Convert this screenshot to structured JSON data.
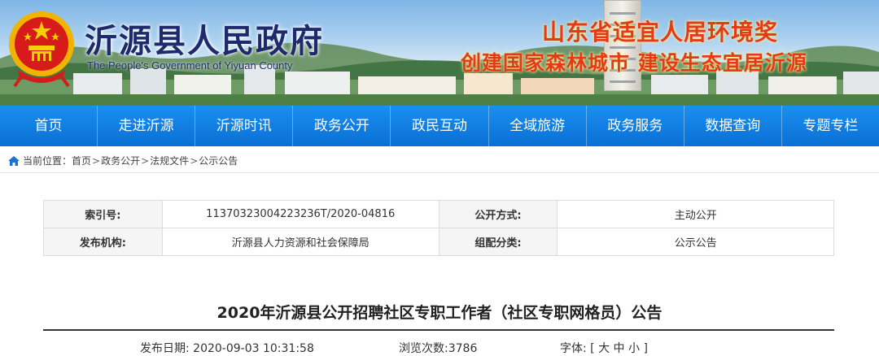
{
  "banner": {
    "title": "沂源县人民政府",
    "subtitle": "The People's Government of Yiyuan County",
    "slogan_line1": "山东省适宜人居环境奖",
    "slogan_line2": "创建国家森林城市 建设生态宜居沂源"
  },
  "nav": {
    "items": [
      "首页",
      "走进沂源",
      "沂源时讯",
      "政务公开",
      "政民互动",
      "全域旅游",
      "政务服务",
      "数据查询",
      "专题专栏"
    ]
  },
  "breadcrumb": {
    "prefix": "当前位置：",
    "items": [
      "首页",
      "政务公开",
      "法规文件",
      "公示公告"
    ],
    "separator": ">"
  },
  "info": {
    "index_label": "索引号:",
    "index_value": "11370323004223236T/2020-04816",
    "method_label": "公开方式:",
    "method_value": "主动公开",
    "publisher_label": "发布机构:",
    "publisher_value": "沂源县人力资源和社会保障局",
    "category_label": "组配分类:",
    "category_value": "公示公告"
  },
  "article": {
    "title": "2020年沂源县公开招聘社区专职工作者（社区专职网格员）公告",
    "date_label": "发布日期:",
    "date_value": "2020-09-03 10:31:58",
    "views_label": "浏览次数:",
    "views_value": "3786",
    "font_label": "字体:",
    "font_open": "[",
    "font_large": "大",
    "font_medium": "中",
    "font_small": "小",
    "font_close": "]"
  },
  "colors": {
    "nav_blue": "#0a6fd6",
    "title_navy": "#1d2a6b",
    "slogan_red": "#e23a1b"
  }
}
